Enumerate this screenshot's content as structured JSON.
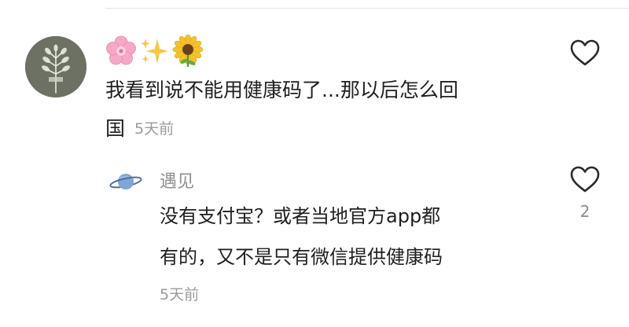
{
  "comment": {
    "emoji_icons": [
      "cherry-blossom-icon",
      "sparkles-icon",
      "sunflower-icon"
    ],
    "text_line1": "我看到说不能用健康码了...那以后怎么回",
    "text_line2": "国",
    "time": "5天前",
    "like_icon": "heart-outline-icon"
  },
  "reply": {
    "avatar_icon": "ringed-planet-icon",
    "username": "遇见",
    "text_line1": "没有支付宝？或者当地官方app都",
    "text_line2": "有的，又不是只有微信提供健康码",
    "time": "5天前",
    "like_icon": "heart-outline-icon",
    "like_count": "2"
  }
}
